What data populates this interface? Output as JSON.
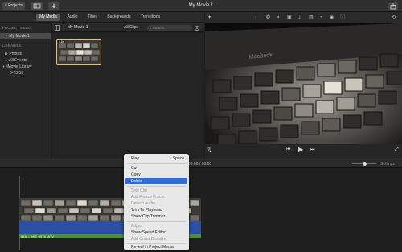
{
  "titlebar": {
    "projects_button": "< Projects",
    "window_title": "My Movie 1"
  },
  "media_tabs": [
    {
      "label": "My Media",
      "active": true
    },
    {
      "label": "Audio",
      "active": false
    },
    {
      "label": "Titles",
      "active": false
    },
    {
      "label": "Backgrounds",
      "active": false
    },
    {
      "label": "Transitions",
      "active": false
    }
  ],
  "sidebar": {
    "project_media_heading": "PROJECT MEDIA",
    "project_item": "My Movie 1",
    "libraries_heading": "LIBRARIES",
    "photos": "Photos",
    "all_events": "All Events",
    "movie_library": "iMovie Library",
    "event_date": "6-23-18"
  },
  "browser": {
    "heading": "My Movie 1",
    "filter": "All Clips",
    "search_placeholder": "Search",
    "thumb_duration": "0.8s"
  },
  "viewer": {
    "laptop_brand": "MacBook"
  },
  "timeline": {
    "timecode": "00:00 / 00:00",
    "settings_label": "Settings",
    "clip_label": "5.0s – IMG_0578.MOV"
  },
  "context_menu": {
    "items": [
      {
        "label": "Play",
        "shortcut": "Space",
        "state": "normal"
      },
      {
        "label": "Cut",
        "shortcut": "",
        "state": "normal"
      },
      {
        "label": "Copy",
        "shortcut": "",
        "state": "normal"
      },
      {
        "label": "Delete",
        "shortcut": "",
        "state": "highlighted"
      },
      {
        "label": "Split Clip",
        "shortcut": "",
        "state": "disabled"
      },
      {
        "label": "Add Freeze Frame",
        "shortcut": "",
        "state": "disabled"
      },
      {
        "label": "Detach Audio",
        "shortcut": "",
        "state": "disabled"
      },
      {
        "label": "Trim To Playhead",
        "shortcut": "",
        "state": "normal"
      },
      {
        "label": "Show Clip Trimmer",
        "shortcut": "",
        "state": "normal"
      },
      {
        "label": "Adjust",
        "shortcut": "",
        "state": "disabled"
      },
      {
        "label": "Show Speed Editor",
        "shortcut": "",
        "state": "normal"
      },
      {
        "label": "Add Cross Dissolve",
        "shortcut": "",
        "state": "disabled"
      },
      {
        "label": "Reveal in Project Media",
        "shortcut": "",
        "state": "normal"
      }
    ]
  },
  "colors": {
    "accent_blue": "#2f6cd8",
    "selection_gold": "#e8c16b",
    "audio_blue": "#2a4fa3",
    "audio_green": "#4f8d3a"
  }
}
